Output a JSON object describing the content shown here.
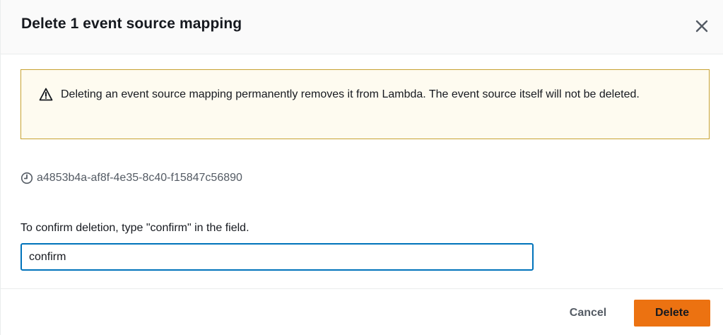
{
  "modal": {
    "title": "Delete 1 event source mapping",
    "close_icon": "close-icon"
  },
  "warning": {
    "icon": "warning-triangle-icon",
    "text": "Deleting an event source mapping permanently removes it from Lambda. The event source itself will not be deleted."
  },
  "resource": {
    "icon": "clock-icon",
    "id": "a4853b4a-af8f-4e35-8c40-f15847c56890"
  },
  "confirm": {
    "label": "To confirm deletion, type \"confirm\" in the field.",
    "value": "confirm"
  },
  "footer": {
    "cancel_label": "Cancel",
    "delete_label": "Delete"
  },
  "colors": {
    "primary_button": "#ec7211",
    "input_focus_border": "#0073bb",
    "warning_border": "#c8a232",
    "warning_background": "#fefbf0"
  }
}
